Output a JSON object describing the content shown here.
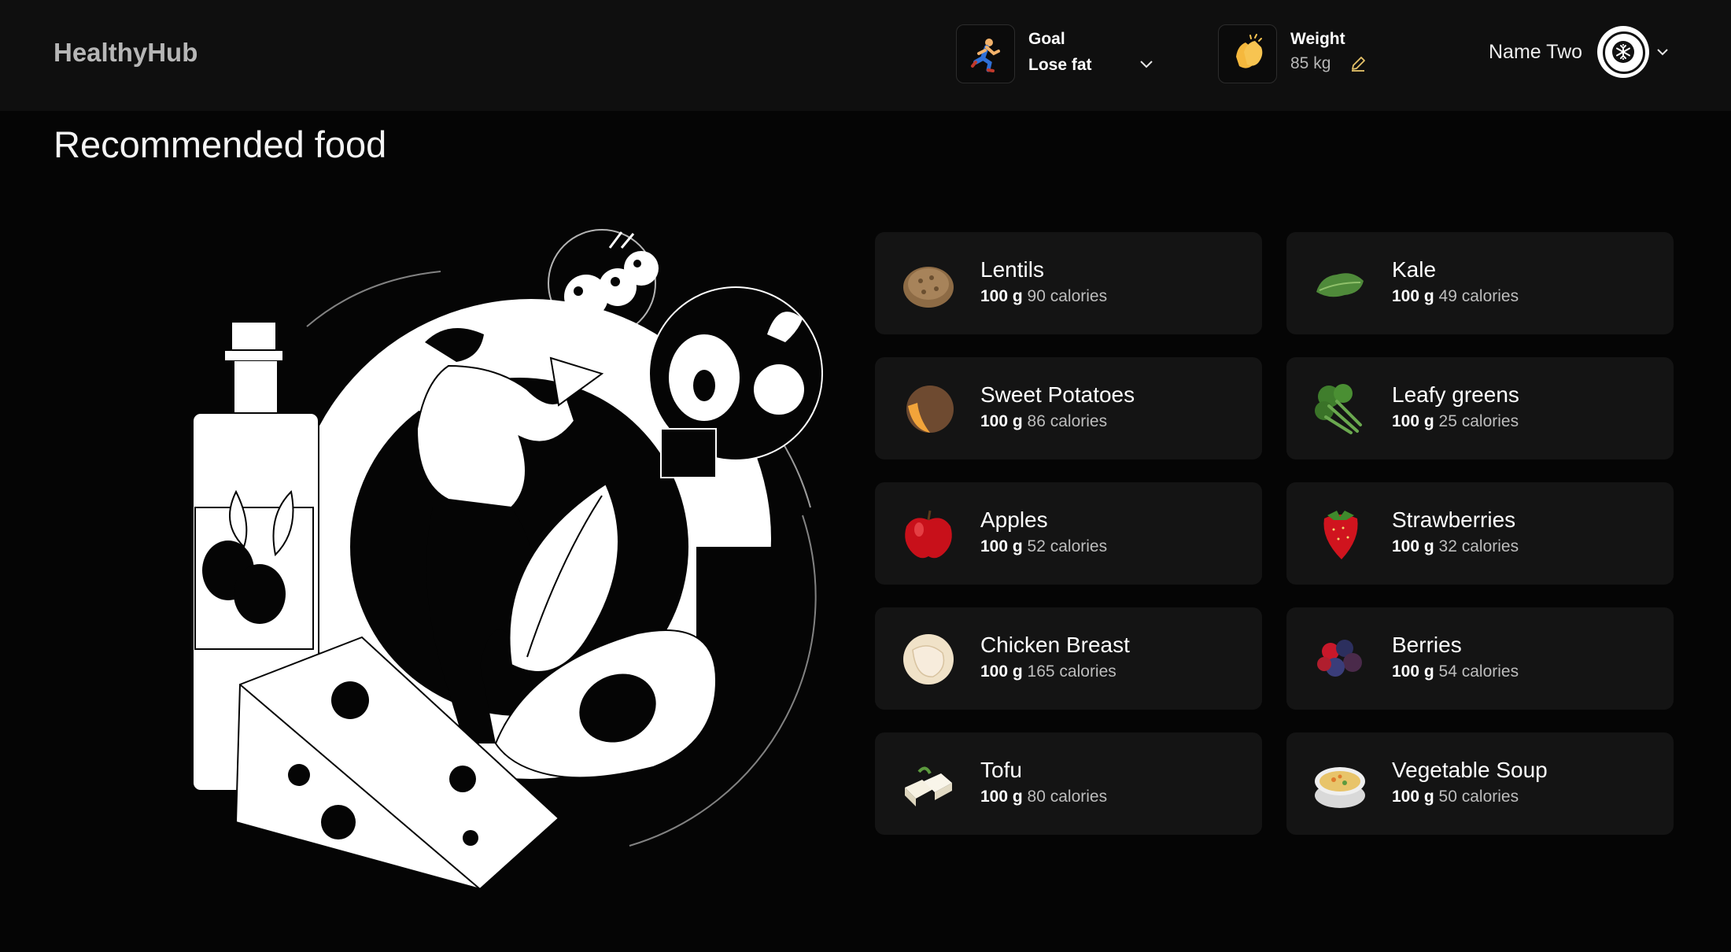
{
  "app": {
    "name": "HealthyHub"
  },
  "header": {
    "goal": {
      "label": "Goal",
      "value": "Lose fat",
      "icon": "running-person-icon"
    },
    "weight": {
      "label": "Weight",
      "value": "85 kg",
      "icon": "clapping-hands-icon"
    },
    "user": {
      "name": "Name Two",
      "avatar_icon": "snowflake-icon"
    }
  },
  "page": {
    "title": "Recommended food"
  },
  "foods": [
    {
      "name": "Lentils",
      "quantity": "100 g",
      "calories": "90 calories"
    },
    {
      "name": "Kale",
      "quantity": "100 g",
      "calories": "49 calories"
    },
    {
      "name": "Sweet Potatoes",
      "quantity": "100 g",
      "calories": "86 calories"
    },
    {
      "name": "Leafy greens",
      "quantity": "100 g",
      "calories": "25 calories"
    },
    {
      "name": "Apples",
      "quantity": "100 g",
      "calories": "52 calories"
    },
    {
      "name": "Strawberries",
      "quantity": "100 g",
      "calories": "32 calories"
    },
    {
      "name": "Chicken Breast",
      "quantity": "100 g",
      "calories": "165 calories"
    },
    {
      "name": "Berries",
      "quantity": "100 g",
      "calories": "54 calories"
    },
    {
      "name": "Tofu",
      "quantity": "100 g",
      "calories": "80 calories"
    },
    {
      "name": "Vegetable Soup",
      "quantity": "100 g",
      "calories": "50 calories"
    }
  ]
}
